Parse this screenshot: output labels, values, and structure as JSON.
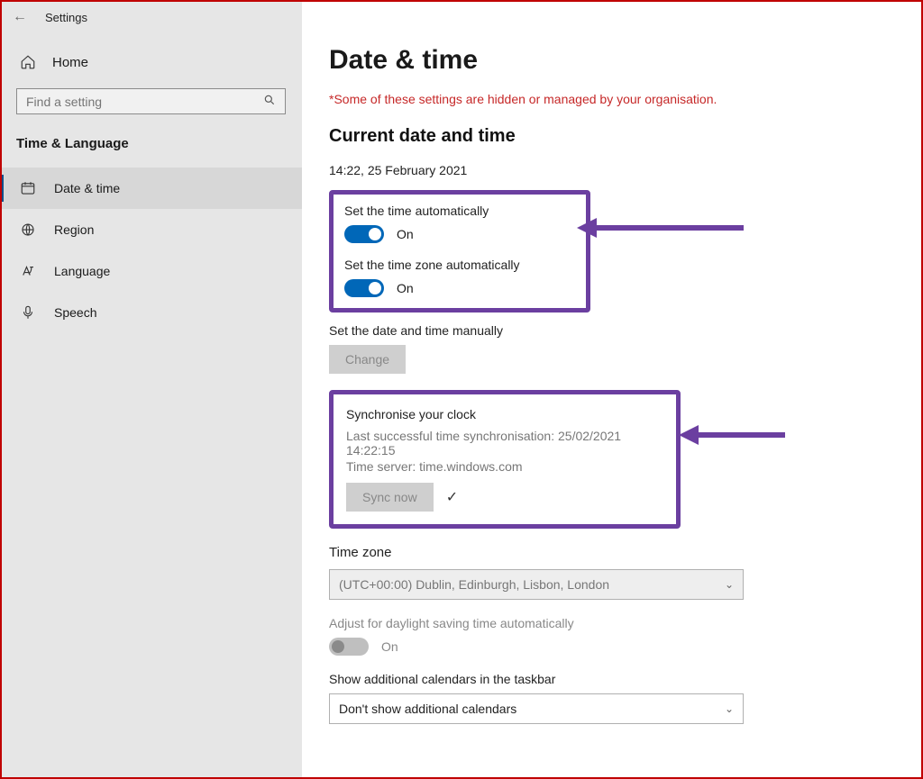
{
  "titlebar": {
    "app_name": "Settings"
  },
  "sidebar": {
    "home_label": "Home",
    "search_placeholder": "Find a setting",
    "section_label": "Time & Language",
    "items": [
      {
        "label": "Date & time",
        "icon": "clock-icon",
        "selected": true
      },
      {
        "label": "Region",
        "icon": "globe-icon",
        "selected": false
      },
      {
        "label": "Language",
        "icon": "language-icon",
        "selected": false
      },
      {
        "label": "Speech",
        "icon": "mic-icon",
        "selected": false
      }
    ]
  },
  "main": {
    "heading": "Date & time",
    "warning": "*Some of these settings are hidden or managed by your organisation.",
    "current_heading": "Current date and time",
    "current_value": "14:22, 25 February 2021",
    "auto_time_label": "Set the time automatically",
    "auto_time_state": "On",
    "auto_tz_label": "Set the time zone automatically",
    "auto_tz_state": "On",
    "manual_label": "Set the date and time manually",
    "change_btn": "Change",
    "sync_heading": "Synchronise your clock",
    "sync_last": "Last successful time synchronisation: 25/02/2021 14:22:15",
    "sync_server": "Time server: time.windows.com",
    "sync_btn": "Sync now",
    "tz_label": "Time zone",
    "tz_value": "(UTC+00:00) Dublin, Edinburgh, Lisbon, London",
    "dst_label": "Adjust for daylight saving time automatically",
    "dst_state": "On",
    "addcal_label": "Show additional calendars in the taskbar",
    "addcal_value": "Don't show additional calendars"
  }
}
